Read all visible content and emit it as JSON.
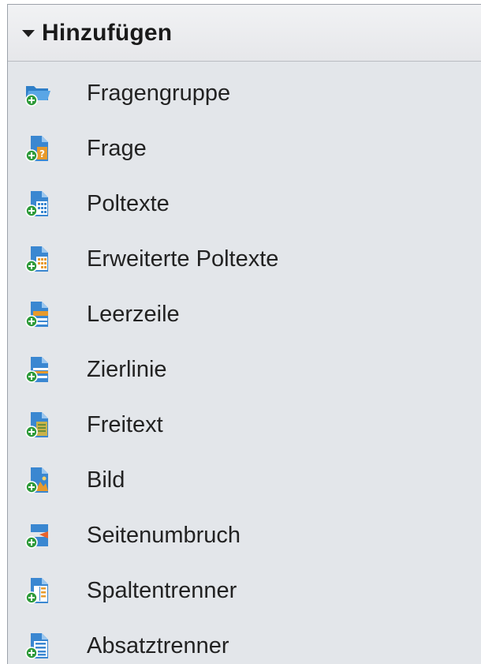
{
  "panel": {
    "title": "Hinzufügen",
    "collapse_icon": "caret-down-icon",
    "items": [
      {
        "label": "Fragengruppe",
        "icon": "add-folder-icon"
      },
      {
        "label": "Frage",
        "icon": "add-question-icon"
      },
      {
        "label": "Poltexte",
        "icon": "add-poltexte-icon"
      },
      {
        "label": "Erweiterte Poltexte",
        "icon": "add-extended-poltexte-icon"
      },
      {
        "label": "Leerzeile",
        "icon": "add-blank-line-icon"
      },
      {
        "label": "Zierlinie",
        "icon": "add-decorative-line-icon"
      },
      {
        "label": "Freitext",
        "icon": "add-free-text-icon"
      },
      {
        "label": "Bild",
        "icon": "add-image-icon"
      },
      {
        "label": "Seitenumbruch",
        "icon": "add-page-break-icon"
      },
      {
        "label": "Spaltentrenner",
        "icon": "add-column-separator-icon"
      },
      {
        "label": "Absatztrenner",
        "icon": "add-paragraph-separator-icon"
      }
    ]
  },
  "colors": {
    "panel_bg": "#e3e6ea",
    "icon_blue": "#3a87d1",
    "icon_green": "#2e9a3a",
    "icon_orange": "#e89a2c"
  }
}
